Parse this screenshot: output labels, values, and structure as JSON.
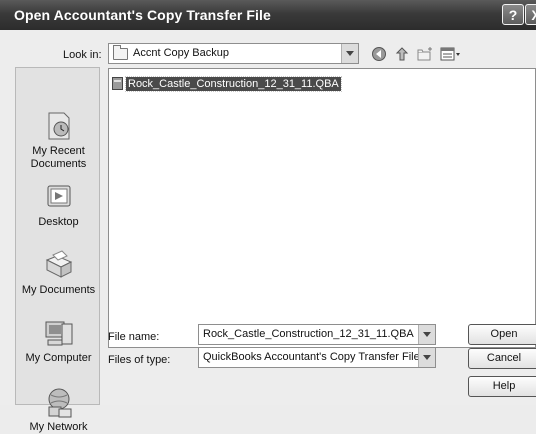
{
  "window": {
    "title": "Open Accountant's Copy Transfer File",
    "help_glyph": "?",
    "close_glyph": "X"
  },
  "lookin": {
    "label": "Look in:",
    "value": "Accnt Copy Backup"
  },
  "places": [
    {
      "label": "My Recent Documents",
      "icon": "recent-documents-icon"
    },
    {
      "label": "Desktop",
      "icon": "desktop-icon"
    },
    {
      "label": "My Documents",
      "icon": "my-documents-icon"
    },
    {
      "label": "My Computer",
      "icon": "my-computer-icon"
    },
    {
      "label": "My Network",
      "icon": "my-network-icon"
    }
  ],
  "files": [
    {
      "name": "Rock_Castle_Construction_12_31_11.QBA",
      "selected": true
    }
  ],
  "filename": {
    "label": "File name:",
    "value": "Rock_Castle_Construction_12_31_11.QBA"
  },
  "filetype": {
    "label": "Files of type:",
    "value": "QuickBooks Accountant's Copy Transfer Files ("
  },
  "buttons": {
    "open": "Open",
    "cancel": "Cancel",
    "help": "Help"
  }
}
